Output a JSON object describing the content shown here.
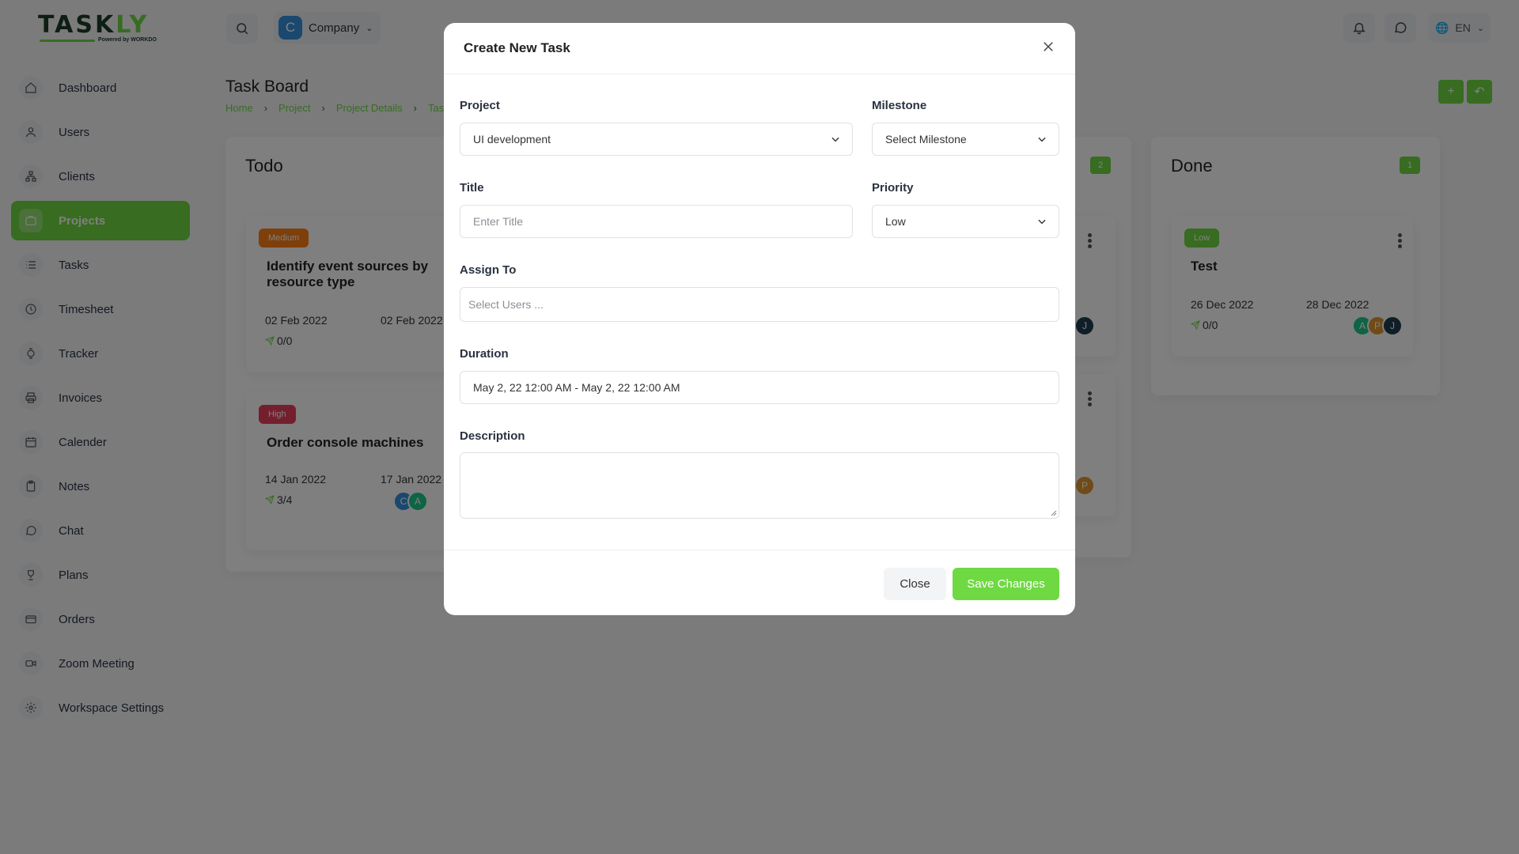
{
  "brand": {
    "logo_text": "TASKLY",
    "powered_text": "Powered by WORKDO",
    "accent": "#6fd943",
    "dark": "#1e3d2b"
  },
  "topbar": {
    "company_initial": "C",
    "company_label": "Company",
    "language": "EN"
  },
  "sidebar": {
    "items": [
      {
        "label": "Dashboard",
        "icon": "home-icon"
      },
      {
        "label": "Users",
        "icon": "user-icon"
      },
      {
        "label": "Clients",
        "icon": "sitemap-icon"
      },
      {
        "label": "Projects",
        "icon": "projects-icon",
        "active": true
      },
      {
        "label": "Tasks",
        "icon": "list-icon"
      },
      {
        "label": "Timesheet",
        "icon": "clock-icon"
      },
      {
        "label": "Tracker",
        "icon": "watch-icon"
      },
      {
        "label": "Invoices",
        "icon": "printer-icon"
      },
      {
        "label": "Calender",
        "icon": "calendar-icon"
      },
      {
        "label": "Notes",
        "icon": "clipboard-icon"
      },
      {
        "label": "Chat",
        "icon": "chat-icon"
      },
      {
        "label": "Plans",
        "icon": "trophy-icon"
      },
      {
        "label": "Orders",
        "icon": "credit-card-icon"
      },
      {
        "label": "Zoom Meeting",
        "icon": "video-icon"
      },
      {
        "label": "Workspace Settings",
        "icon": "gear-icon"
      }
    ]
  },
  "page": {
    "title": "Task Board",
    "breadcrumb": [
      "Home",
      "Project",
      "Project Details",
      "Tas"
    ],
    "add_button": "+",
    "back_button": "↶"
  },
  "board": {
    "todo": {
      "title": "Todo",
      "tasks": [
        {
          "priority": "Medium",
          "title": "Identify event sources by resource type",
          "start": "02 Feb 2022",
          "end": "02 Feb 2022",
          "progress": "0/0"
        },
        {
          "priority": "High",
          "title": "Order console machines",
          "start": "14 Jan 2022",
          "end": "17 Jan 2022",
          "progress": "3/4",
          "avatars": [
            "C",
            "A"
          ]
        }
      ]
    },
    "review": {
      "count": "2",
      "avatars": [
        "J",
        "P"
      ]
    },
    "done": {
      "title": "Done",
      "count": "1",
      "tasks": [
        {
          "priority": "Low",
          "title": "Test",
          "start": "26 Dec 2022",
          "end": "28 Dec 2022",
          "progress": "0/0",
          "avatars": [
            "A",
            "P",
            "J"
          ]
        }
      ]
    }
  },
  "modal": {
    "title": "Create New Task",
    "project_label": "Project",
    "project_value": "UI development",
    "milestone_label": "Milestone",
    "milestone_value": "Select Milestone",
    "title_label": "Title",
    "title_placeholder": "Enter Title",
    "priority_label": "Priority",
    "priority_value": "Low",
    "assign_label": "Assign To",
    "assign_placeholder": "Select Users ...",
    "duration_label": "Duration",
    "duration_value": "May 2, 22 12:00 AM - May 2, 22 12:00 AM",
    "description_label": "Description",
    "close_button": "Close",
    "save_button": "Save Changes"
  },
  "colors": {
    "medium": "#fd7e14",
    "high": "#e83e5c",
    "low": "#6fd943",
    "overlay": "rgba(0,0,0,0.5)"
  }
}
